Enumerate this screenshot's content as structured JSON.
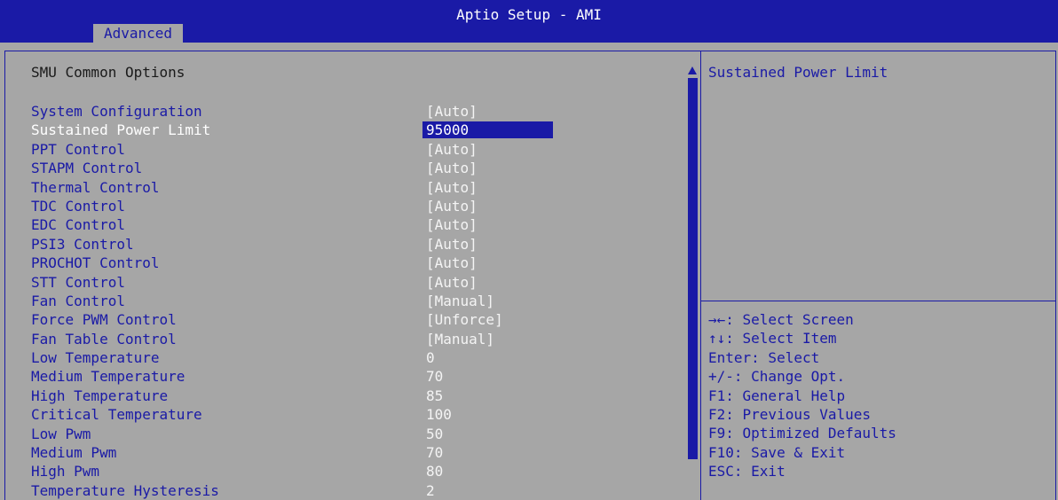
{
  "header": {
    "title": "Aptio Setup - AMI",
    "active_tab": "Advanced"
  },
  "main": {
    "section_title": "SMU Common Options",
    "items": [
      {
        "label": "System Configuration",
        "value": "[Auto]"
      },
      {
        "label": "Sustained Power Limit",
        "value": "95000",
        "selected": true
      },
      {
        "label": "PPT Control",
        "value": "[Auto]"
      },
      {
        "label": "STAPM Control",
        "value": "[Auto]"
      },
      {
        "label": "Thermal Control",
        "value": "[Auto]"
      },
      {
        "label": "TDC Control",
        "value": "[Auto]"
      },
      {
        "label": "EDC Control",
        "value": "[Auto]"
      },
      {
        "label": "PSI3 Control",
        "value": "[Auto]"
      },
      {
        "label": "PROCHOT Control",
        "value": "[Auto]"
      },
      {
        "label": "STT Control",
        "value": "[Auto]"
      },
      {
        "label": "Fan Control",
        "value": "[Manual]"
      },
      {
        "label": "Force PWM Control",
        "value": "[Unforce]"
      },
      {
        "label": "Fan Table Control",
        "value": "[Manual]"
      },
      {
        "label": "Low Temperature",
        "value": "0"
      },
      {
        "label": "Medium Temperature",
        "value": "70"
      },
      {
        "label": "High Temperature",
        "value": "85"
      },
      {
        "label": "Critical Temperature",
        "value": "100"
      },
      {
        "label": "Low Pwm",
        "value": "50"
      },
      {
        "label": "Medium Pwm",
        "value": "70"
      },
      {
        "label": "High Pwm",
        "value": "80"
      },
      {
        "label": "Temperature Hysteresis",
        "value": "2"
      }
    ]
  },
  "help": {
    "title": "Sustained Power Limit",
    "keys": [
      "→←: Select Screen",
      "↑↓: Select Item",
      "Enter: Select",
      "+/-: Change Opt.",
      "F1: General Help",
      "F2: Previous Values",
      "F9: Optimized Defaults",
      "F10: Save & Exit",
      "ESC: Exit"
    ]
  },
  "colors": {
    "background": "#a6a6a6",
    "accent_blue": "#1a1aa6",
    "value_text": "#f4f4f4"
  }
}
